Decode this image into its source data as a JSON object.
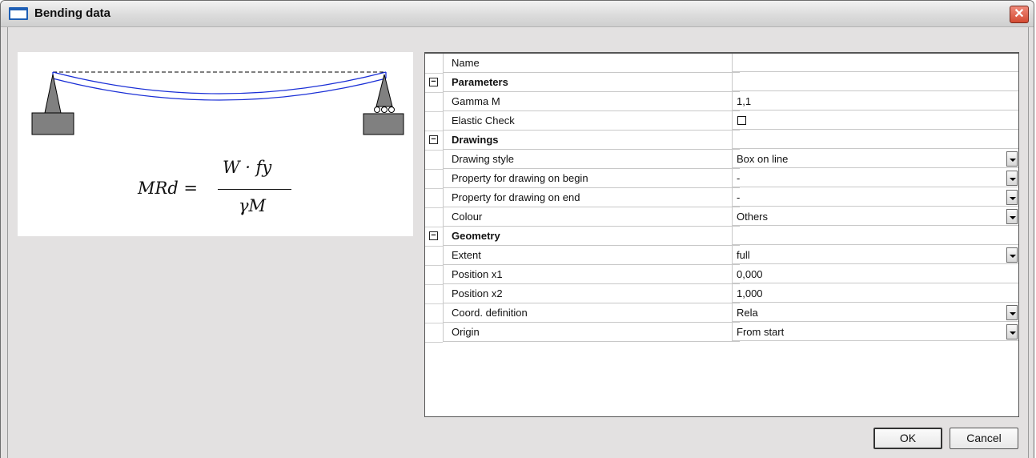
{
  "window": {
    "title": "Bending data",
    "title_icon": "window-icon",
    "close_glyph": "✕"
  },
  "formula": {
    "lhs": "MRd =",
    "numerator": "W · fy",
    "denominator": "γM"
  },
  "properties": [
    {
      "type": "item",
      "name": "Name",
      "value": ""
    },
    {
      "type": "category",
      "name": "Parameters",
      "toggle": "−"
    },
    {
      "type": "item",
      "name": "Gamma M",
      "value": "1,1"
    },
    {
      "type": "checkbox",
      "name": "Elastic Check",
      "checked": false
    },
    {
      "type": "category",
      "name": "Drawings",
      "toggle": "−"
    },
    {
      "type": "dropdown",
      "name": "Drawing style",
      "value": "Box on line"
    },
    {
      "type": "dropdown",
      "name": "Property for drawing on begin",
      "value": "-"
    },
    {
      "type": "dropdown",
      "name": "Property for drawing on end",
      "value": "-"
    },
    {
      "type": "dropdown",
      "name": "Colour",
      "value": "Others"
    },
    {
      "type": "category",
      "name": "Geometry",
      "toggle": "−"
    },
    {
      "type": "dropdown",
      "name": "Extent",
      "value": "full"
    },
    {
      "type": "item",
      "name": "Position x1",
      "value": "0,000"
    },
    {
      "type": "item",
      "name": "Position x2",
      "value": "1,000"
    },
    {
      "type": "dropdown",
      "name": "Coord. definition",
      "value": "Rela"
    },
    {
      "type": "dropdown",
      "name": "Origin",
      "value": "From start"
    }
  ],
  "buttons": {
    "ok": "OK",
    "cancel": "Cancel"
  },
  "colors": {
    "beam": "#1a2fd6",
    "support": "#808080"
  }
}
